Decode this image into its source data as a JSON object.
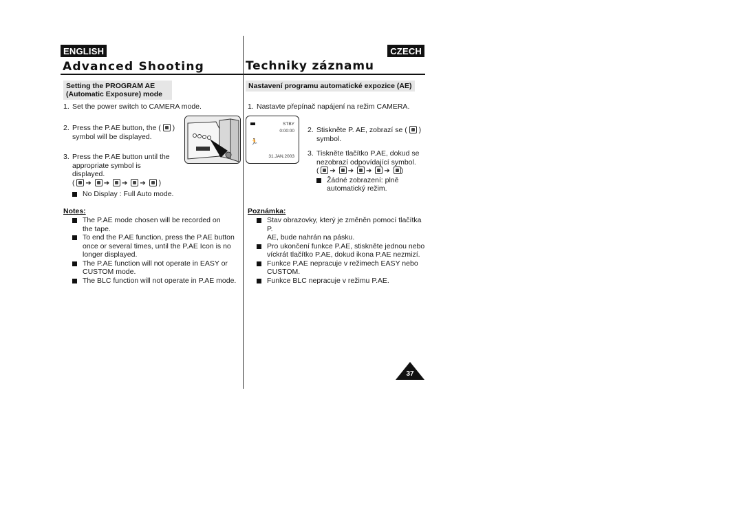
{
  "header": {
    "left_lang": "ENGLISH",
    "right_lang": "CZECH",
    "left_title": "Advanced Shooting",
    "right_title": "Techniky záznamu"
  },
  "english": {
    "section_title_line1": "Setting the PROGRAM AE",
    "section_title_line2": "(Automatic Exposure) mode",
    "steps": [
      {
        "num": "1.",
        "lines": [
          "Set the power switch to CAMERA mode."
        ]
      },
      {
        "num": "2.",
        "lines": [
          "Press the P.AE button, the (",
          ")",
          "symbol will be displayed."
        ]
      },
      {
        "num": "3.",
        "lines": [
          "Press the P.AE button until the",
          "appropriate symbol is",
          "displayed."
        ]
      }
    ],
    "sequence_open": "(",
    "sequence_close": ")",
    "no_display": "No Display : Full Auto mode.",
    "notes_label": "Notes:",
    "notes": [
      {
        "line1": "The P.AE mode chosen will be recorded on",
        "line2": "the tape.",
        "line3": ""
      },
      {
        "line1": "To end the P.AE function, press the P.AE button",
        "line2": "once or several times, until the P.AE Icon is no",
        "line3": "longer displayed."
      },
      {
        "line1": "The P.AE function will not operate in EASY or",
        "line2": "CUSTOM mode.",
        "line3": ""
      },
      {
        "line1": "The BLC function will not operate in P.AE mode.",
        "line2": "",
        "line3": ""
      }
    ]
  },
  "czech": {
    "section_title": "Nastavení programu automatické expozice (AE)",
    "steps": [
      {
        "num": "1.",
        "lines": [
          "Nastavte přepínač napájení na režim CAMERA."
        ]
      },
      {
        "num": "2.",
        "lines": [
          "Stiskněte P. AE, zobrazí se (",
          ")",
          "symbol."
        ]
      },
      {
        "num": "3.",
        "lines": [
          "Tiskněte tlačítko P.AE, dokud se",
          "nezobrazí odpovídající symbol."
        ]
      }
    ],
    "sequence_open": "(",
    "sequence_close": ")",
    "no_display_line1": "Žádné zobrazení: plně",
    "no_display_line2": "automatický režim.",
    "notes_label": "Poznámka:",
    "notes": [
      {
        "line1": "Stav obrazovky, který je změněn pomocí tlačítka P.",
        "line2": "AE, bude nahrán na pásku."
      },
      {
        "line1": "Pro ukončení funkce P.AE, stiskněte jednou nebo",
        "line2": "víckrát tlačítko P.AE, dokud ikona P.AE nezmizí."
      },
      {
        "line1": "Funkce P.AE nepracuje v režimech EASY nebo",
        "line2": "CUSTOM."
      },
      {
        "line1": "Funkce BLC nepracuje v režimu P.AE.",
        "line2": ""
      }
    ]
  },
  "lcd": {
    "status": "STBY",
    "timecode": "0:00:00",
    "date": "31.JAN.2003",
    "battery_icon": "battery-icon",
    "mode_icon": "sports-mode-icon"
  },
  "icons": {
    "pae_sequence": [
      "sports-mode-icon",
      "portrait-mode-icon",
      "spotlight-mode-icon",
      "sand-snow-mode-icon",
      "high-speed-shutter-icon"
    ],
    "arrow": "➔"
  },
  "page": {
    "number": "37"
  }
}
